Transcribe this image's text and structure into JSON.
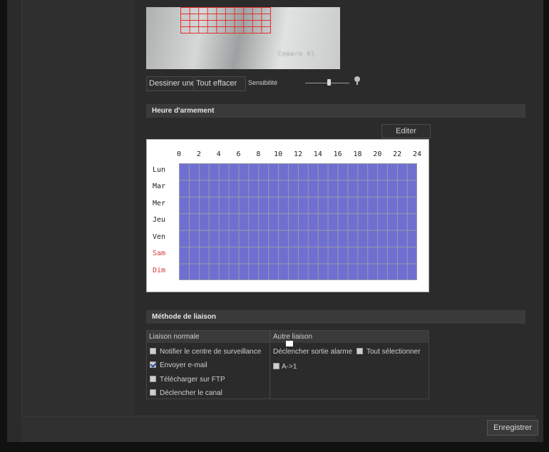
{
  "camera": {
    "osd_text": "Camera 01"
  },
  "toolbar": {
    "draw_label": "Dessiner une zone",
    "clear_label": "Tout effacer",
    "sensitivity_label": "Sensibilité",
    "sensitivity_level": 0.55
  },
  "arming": {
    "title": "Heure d'armement",
    "edit_label": "Editer",
    "hours": [
      "0",
      "2",
      "4",
      "6",
      "8",
      "10",
      "12",
      "14",
      "16",
      "18",
      "20",
      "22",
      "24"
    ],
    "days": [
      "Lun",
      "Mar",
      "Mer",
      "Jeu",
      "Ven",
      "Sam",
      "Dim"
    ],
    "weekend_color": "#d63a3a",
    "armed_color": "#6f6fd1"
  },
  "linkage": {
    "title": "Méthode de liaison",
    "normal_title": "Liaison normale",
    "other_title": "Autre liaison",
    "normal_items": [
      {
        "label": "Notifier le centre de surveillance",
        "checked": false
      },
      {
        "label": "Envoyer e-mail",
        "checked": true
      },
      {
        "label": "Télécharger sur FTP",
        "checked": false
      },
      {
        "label": "Déclencher le canal",
        "checked": false
      }
    ],
    "alarm_out_label": "Déclencher sortie alarme",
    "select_all_label": "Tout sélectionner",
    "alarm_channel_label": "A->1"
  },
  "footer": {
    "save_label": "Enregistrer"
  }
}
